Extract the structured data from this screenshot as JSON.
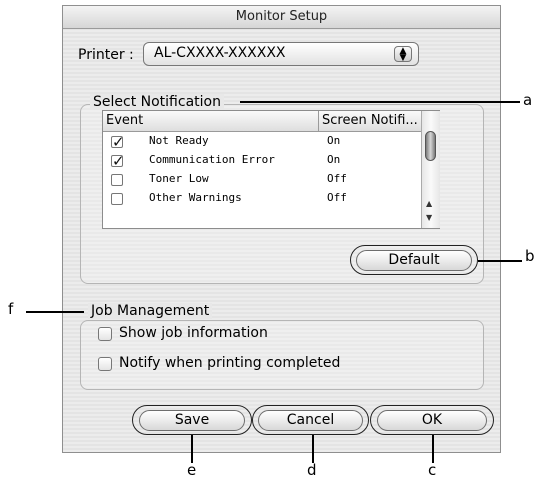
{
  "window": {
    "title": "Monitor Setup"
  },
  "printer": {
    "label": "Printer :",
    "value": "AL-CXXXX-XXXXXX",
    "arrows_icon": "popup-arrows-icon"
  },
  "notification": {
    "group_label": "Select Notification",
    "columns": [
      "Event",
      "Screen Notifi..."
    ],
    "rows": [
      {
        "event": "Not Ready",
        "value": "On",
        "checked": true
      },
      {
        "event": "Communication Error",
        "value": "On",
        "checked": true
      },
      {
        "event": "Toner Low",
        "value": "Off",
        "checked": false
      },
      {
        "event": "Other Warnings",
        "value": "Off",
        "checked": false
      }
    ],
    "default_label": "Default"
  },
  "job": {
    "group_label": "Job Management",
    "show_job_info": "Show job information",
    "notify_completed": "Notify when printing completed"
  },
  "buttons": {
    "save": "Save",
    "cancel": "Cancel",
    "ok": "OK"
  },
  "callouts": {
    "a": "a",
    "b": "b",
    "c": "c",
    "d": "d",
    "e": "e",
    "f": "f"
  }
}
